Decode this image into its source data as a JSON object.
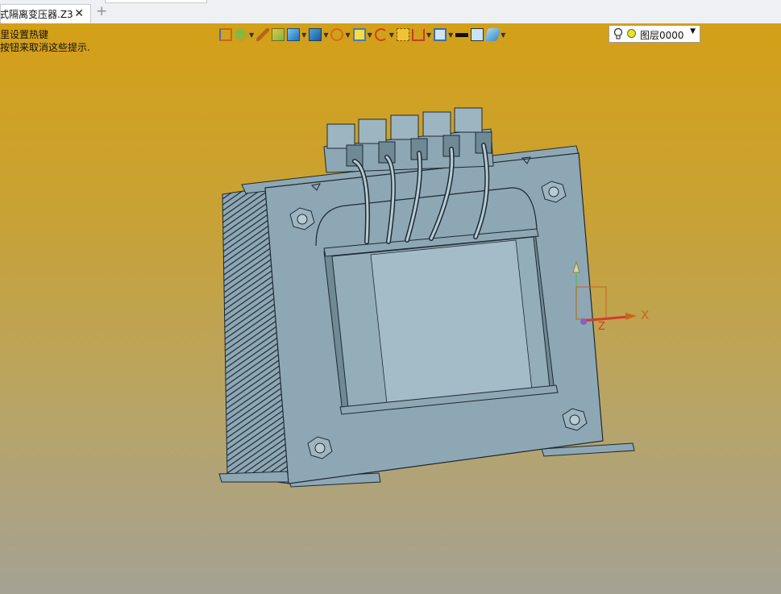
{
  "tabs": {
    "active_title": "式隔离变压器.Z3",
    "close_glyph": "✕",
    "add_glyph": "+"
  },
  "hints": {
    "line1": "里设置热键",
    "line2": "按钮来取消这些提示."
  },
  "toolbar": {
    "icons": [
      "import-icon",
      "color-fill-icon",
      "brush-icon",
      "solid-shade-icon",
      "cube-view-icon",
      "render-mode-icon",
      "sphere-icon",
      "zoom-icon",
      "rotate-icon",
      "section-icon",
      "dimension-icon",
      "display-icon",
      "line-color-icon",
      "fill-color-icon",
      "layer-style-icon"
    ]
  },
  "layer": {
    "name": "图层0000",
    "caret": "▼",
    "dot_color": "#e8e22a"
  },
  "axis": {
    "x_label": "X",
    "z_label": "Z"
  },
  "colors": {
    "model_body": "#8ea7b4",
    "model_shadow": "#6f8995",
    "model_edge": "#1d2a33",
    "axis_x": "#c8651c",
    "axis_z": "#d23b2a"
  }
}
